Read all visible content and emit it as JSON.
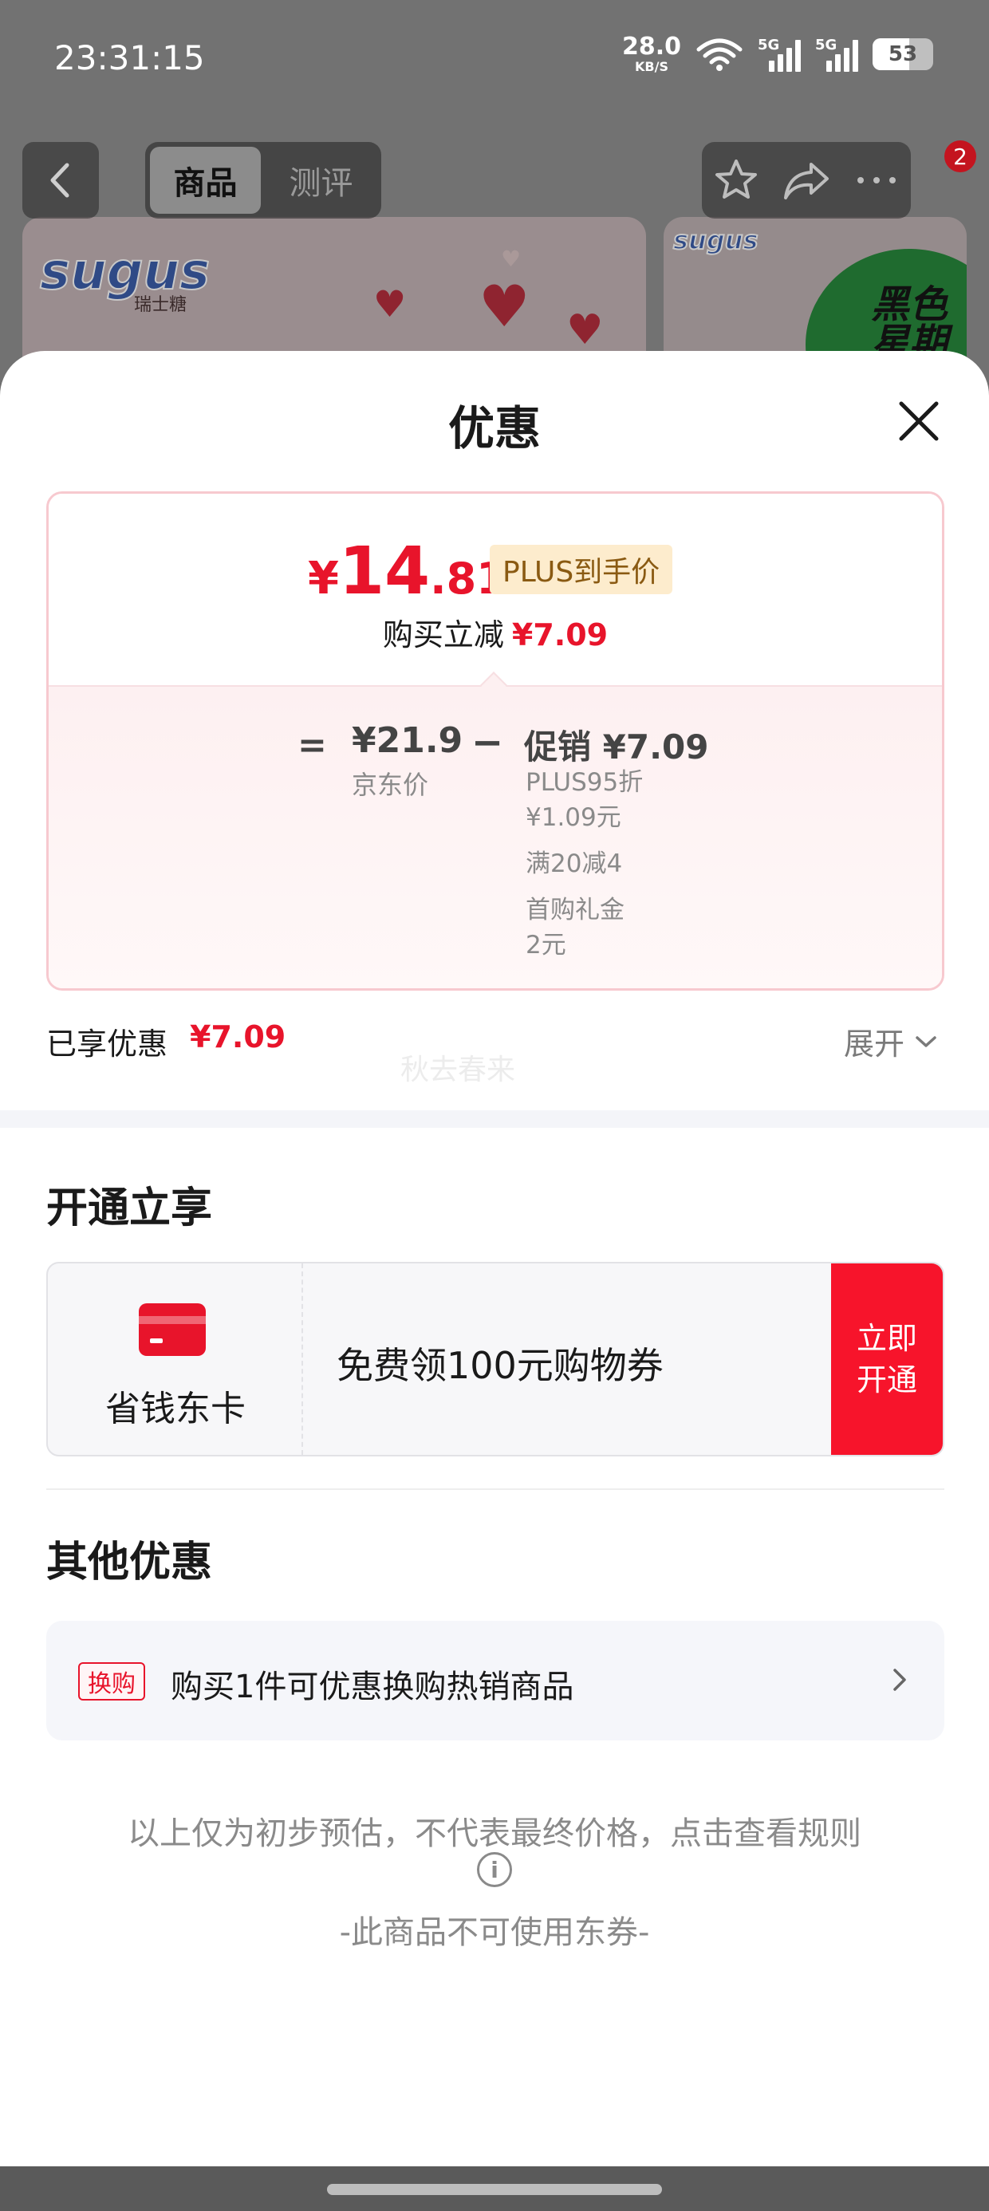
{
  "status_bar": {
    "time": "23:31:15",
    "net_speed": "28.0",
    "net_unit": "KB/S",
    "sim1": "5G",
    "sim2": "5G",
    "battery": "53"
  },
  "nav": {
    "tabs": [
      {
        "label": "商品",
        "active": true
      },
      {
        "label": "测评",
        "active": false
      }
    ],
    "notification_count": "2"
  },
  "banner": {
    "brand": "sugus",
    "brand_sub": "瑞士糖",
    "promo_text": "黑色星期五"
  },
  "sheet": {
    "title": "优惠",
    "price_card": {
      "currency": "¥",
      "final_int": "14",
      "final_dec": ".81",
      "plus_tag": "PLUS到手价",
      "reduce_label": "购买立减",
      "reduce_amount": "¥7.09",
      "equals": "=",
      "jd_price": "¥21.9",
      "jd_label": "京东价",
      "minus": "−",
      "promo_head": "促销 ¥7.09",
      "promo_items": [
        "PLUS95折",
        "¥1.09元",
        "满20减4",
        "首购礼金",
        "2元"
      ]
    },
    "enjoyed_label": "已享优惠",
    "enjoyed_amount": "¥7.09",
    "watermark": "秋去春来",
    "expand_label": "展开",
    "open_section": {
      "title": "开通立享",
      "card_name": "省钱东卡",
      "card_desc": "免费领100元购物券",
      "open_button": "立即开通"
    },
    "other_section": {
      "title": "其他优惠",
      "exchange_tag": "换购",
      "exchange_text": "购买1件可优惠换购热销商品"
    },
    "note": "以上仅为初步预估，不代表最终价格，点击查看规则",
    "note2": "-此商品不可使用东券-"
  },
  "colors": {
    "accent_red": "#e8142b",
    "plus_tag_bg": "#fdeccd",
    "plus_tag_text": "#8a5a12"
  }
}
